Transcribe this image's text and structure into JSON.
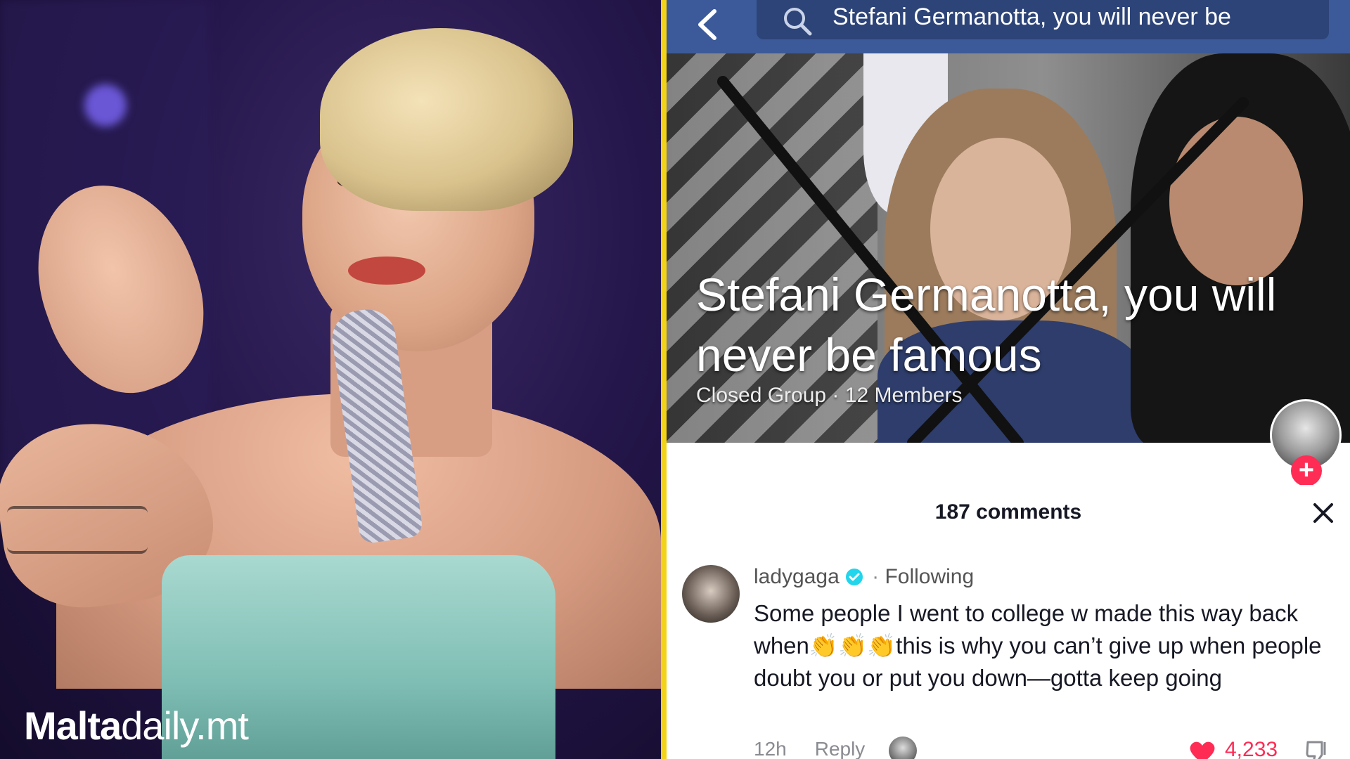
{
  "left_photo": {
    "logo": {
      "bold": "Malta",
      "light": "daily.mt"
    }
  },
  "search": {
    "query": "Stefani Germanotta, you will never be"
  },
  "group_cover": {
    "title": "Stefani Germanotta, you will never be famous",
    "meta": "Closed Group · 12 Members"
  },
  "comments_sheet": {
    "count_label": "187 comments",
    "comment": {
      "username": "ladygaga",
      "separator": " · ",
      "following": "Following",
      "text": "Some people I went to college w made this way back when👏👏👏this is why you can’t give up when people doubt you or put you down—gotta keep going",
      "time": "12h",
      "reply": "Reply",
      "likes": "4,233"
    }
  },
  "colors": {
    "divider": "#f3d21a",
    "facebook_bar": "#3c5a99",
    "like": "#fe2c55",
    "verified": "#20d5ec"
  }
}
